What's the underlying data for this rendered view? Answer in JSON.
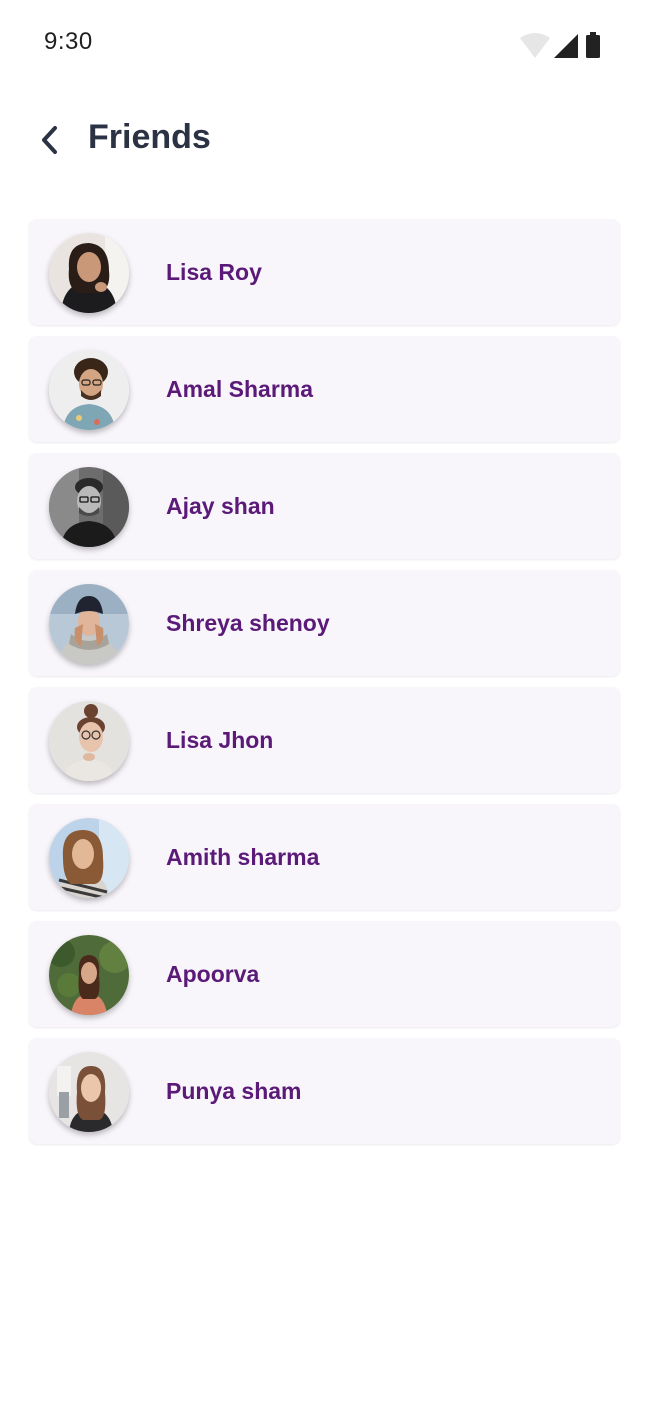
{
  "status_bar": {
    "time": "9:30",
    "icons": [
      "wifi-icon",
      "cellular-signal-icon",
      "battery-icon"
    ]
  },
  "header": {
    "title": "Friends",
    "back_icon": "chevron-left-icon"
  },
  "colors": {
    "name_text": "#5b1a78",
    "title_text": "#2b3243",
    "card_background": "#f8f5fb"
  },
  "friends": [
    {
      "name": "Lisa Roy"
    },
    {
      "name": "Amal Sharma"
    },
    {
      "name": "Ajay shan"
    },
    {
      "name": "Shreya shenoy"
    },
    {
      "name": "Lisa Jhon"
    },
    {
      "name": "Amith sharma"
    },
    {
      "name": "Apoorva"
    },
    {
      "name": "Punya sham"
    }
  ]
}
